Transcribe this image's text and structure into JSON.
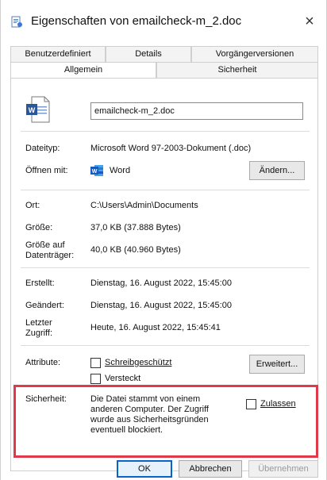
{
  "window": {
    "title": "Eigenschaften von emailcheck-m_2.doc",
    "close_symbol": "×"
  },
  "tabs": {
    "top_row": [
      {
        "label": "Benutzerdefiniert"
      },
      {
        "label": "Details"
      },
      {
        "label": "Vorgängerversionen"
      }
    ],
    "bottom_row": [
      {
        "label": "Allgemein",
        "active": true
      },
      {
        "label": "Sicherheit",
        "active": false
      }
    ]
  },
  "general": {
    "filename": "emailcheck-m_2.doc",
    "filetype_label": "Dateityp:",
    "filetype_value": "Microsoft Word 97-2003-Dokument (.doc)",
    "openwith_label": "Öffnen mit:",
    "openwith_value": "Word",
    "change_button": "Ändern...",
    "location_label": "Ort:",
    "location_value": "C:\\Users\\Admin\\Documents",
    "size_label": "Größe:",
    "size_value": "37,0 KB (37.888 Bytes)",
    "disk_size_label_1": "Größe auf",
    "disk_size_label_2": "Datenträger:",
    "disk_size_value": "40,0 KB (40.960 Bytes)",
    "created_label": "Erstellt:",
    "created_value": "Dienstag, 16. August 2022, 15:45:00",
    "modified_label": "Geändert:",
    "modified_value": "Dienstag, 16. August 2022, 15:45:00",
    "accessed_label_1": "Letzter",
    "accessed_label_2": "Zugriff:",
    "accessed_value": "Heute, 16. August 2022, 15:45:41",
    "attributes_label": "Attribute:",
    "readonly_label": "Schreibgeschützt",
    "hidden_label": "Versteckt",
    "advanced_button": "Erweitert...",
    "security_label": "Sicherheit:",
    "security_text": "Die Datei stammt von einem anderen Computer. Der Zugriff wurde aus Sicherheitsgründen eventuell blockiert.",
    "allow_label": "Zulassen"
  },
  "footer": {
    "ok": "OK",
    "cancel": "Abbrechen",
    "apply": "Übernehmen"
  },
  "colors": {
    "highlight_border": "#e03a4a",
    "word_blue": "#2b579a",
    "primary_border": "#0a64c8"
  }
}
